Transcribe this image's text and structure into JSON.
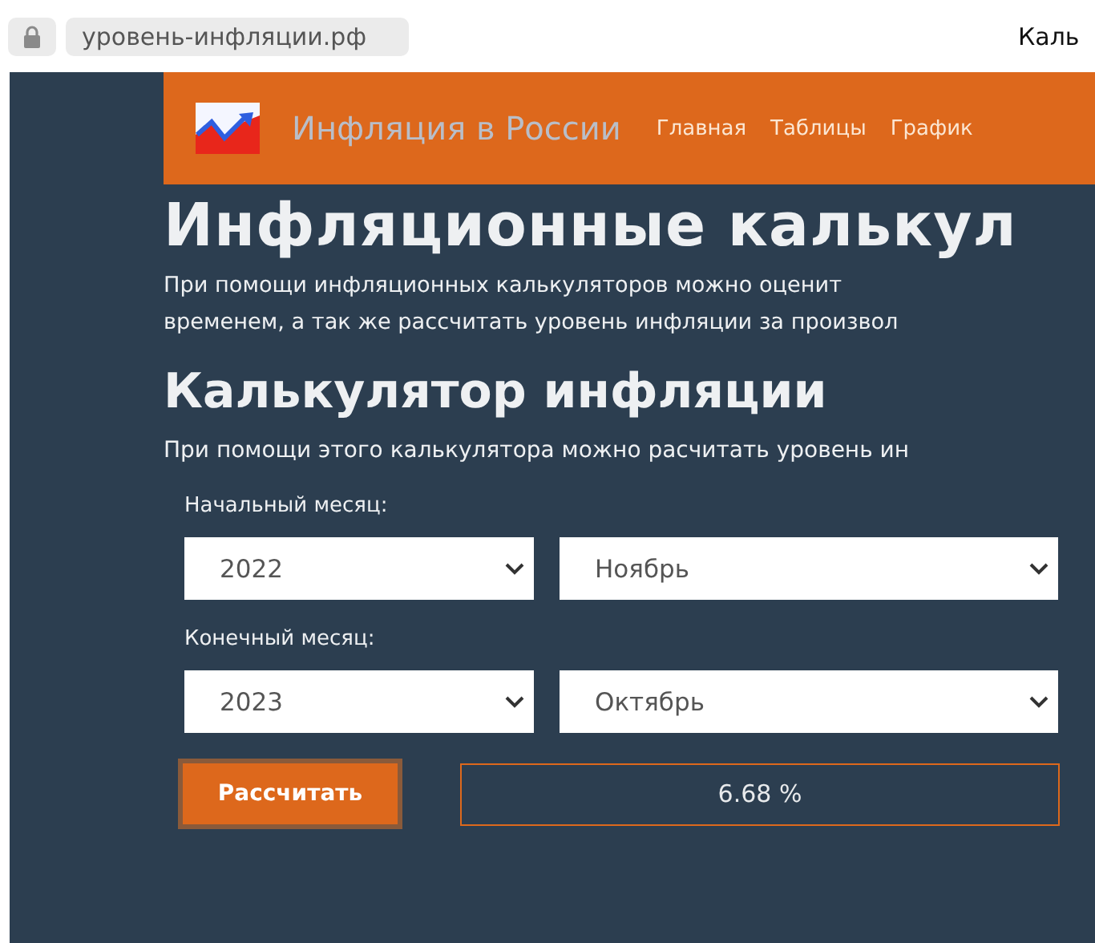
{
  "browser": {
    "url": "уровень-инфляции.рф",
    "tab_title": "Каль"
  },
  "header": {
    "site_title": "Инфляция в России",
    "nav": [
      {
        "label": "Главная"
      },
      {
        "label": "Таблицы"
      },
      {
        "label": "График"
      }
    ]
  },
  "page": {
    "title": "Инфляционные калькул",
    "intro_lines": [
      "При помощи инфляционных калькуляторов можно оценит",
      "временем, а так же рассчитать уровень инфляции за произвол"
    ],
    "section_title": "Калькулятор инфляции",
    "section_text": "При помощи этого калькулятора можно расчитать уровень ин"
  },
  "calculator": {
    "periods": [
      {
        "label": "Начальный месяц:",
        "year": "2022",
        "month": "Ноябрь"
      },
      {
        "label": "Конечный месяц:",
        "year": "2023",
        "month": "Октябрь"
      }
    ],
    "button": "Рассчитать",
    "result": "6.68 %"
  }
}
